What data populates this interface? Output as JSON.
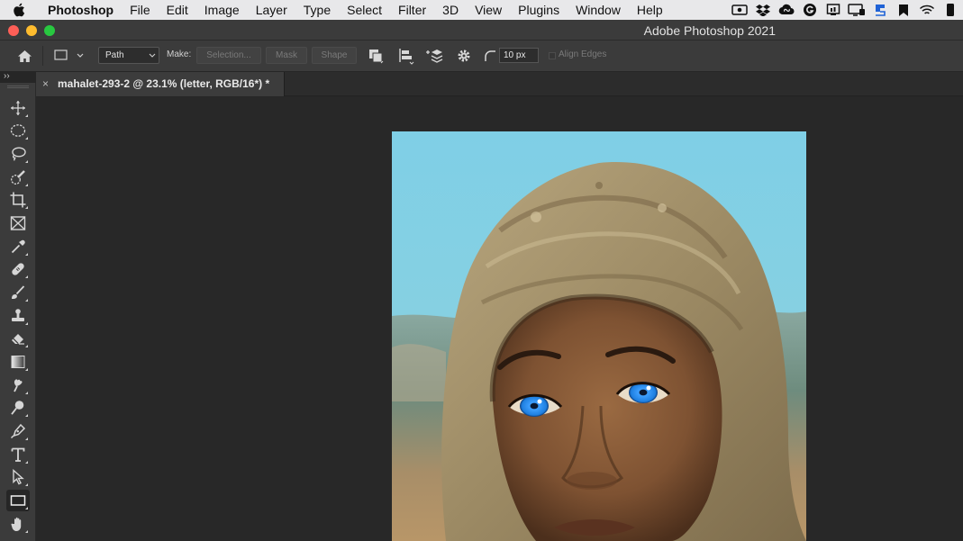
{
  "menubar": {
    "app_name": "Photoshop",
    "items": [
      "File",
      "Edit",
      "Image",
      "Layer",
      "Type",
      "Select",
      "Filter",
      "3D",
      "View",
      "Plugins",
      "Window",
      "Help"
    ],
    "status_icons": [
      "screen-recorder-icon",
      "dropbox-icon",
      "creative-cloud-icon",
      "grammarly-icon",
      "airplay-icon",
      "display-icon",
      "sync-icon",
      "bookmark-icon",
      "wifi-icon",
      "battery-icon"
    ]
  },
  "window": {
    "title": "Adobe Photoshop 2021"
  },
  "options_bar": {
    "mode_value": "Path",
    "make_label": "Make:",
    "selection_button": "Selection...",
    "mask_button": "Mask",
    "shape_button": "Shape",
    "corner_radius": "10 px",
    "align_edges_label": "Align Edges"
  },
  "panel_toggle": "››",
  "document_tab": {
    "close_glyph": "×",
    "title": "mahalet-293-2 @ 23.1% (letter, RGB/16*) *"
  },
  "toolbar": {
    "tools": [
      "move-tool-icon",
      "elliptical-marquee-tool-icon",
      "lasso-tool-icon",
      "quick-selection-tool-icon",
      "crop-tool-icon",
      "frame-tool-icon",
      "eyedropper-tool-icon",
      "healing-brush-tool-icon",
      "brush-tool-icon",
      "clone-stamp-tool-icon",
      "eraser-tool-icon",
      "gradient-tool-icon",
      "smudge-tool-icon",
      "dodge-tool-icon",
      "pen-tool-icon",
      "type-tool-icon",
      "path-selection-tool-icon",
      "rectangle-tool-icon",
      "hand-tool-icon"
    ],
    "active_tool": "rectangle-tool-icon"
  },
  "colors": {
    "app_background": "#282828",
    "panel": "#3b3b3b",
    "sky": "#7ccde3",
    "eye_blue": "#1e7fe0"
  }
}
